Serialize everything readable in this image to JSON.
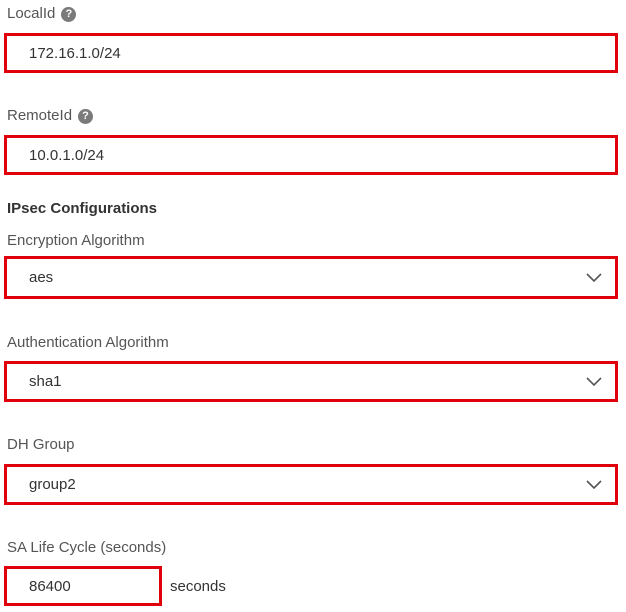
{
  "local_id": {
    "label": "LocalId",
    "help_icon": "question-circle-icon",
    "value": "172.16.1.0/24"
  },
  "remote_id": {
    "label": "RemoteId",
    "help_icon": "question-circle-icon",
    "value": "10.0.1.0/24"
  },
  "ipsec": {
    "section_title": "IPsec Configurations",
    "encryption": {
      "label": "Encryption Algorithm",
      "selected": "aes",
      "icon": "chevron-down-icon"
    },
    "authentication": {
      "label": "Authentication Algorithm",
      "selected": "sha1",
      "icon": "chevron-down-icon"
    },
    "dh_group": {
      "label": "DH Group",
      "selected": "group2",
      "icon": "chevron-down-icon"
    },
    "sa_life_cycle": {
      "label": "SA Life Cycle (seconds)",
      "value": "86400",
      "suffix": "seconds"
    }
  },
  "colors": {
    "highlight_border": "#e0000c",
    "label_text": "#555555",
    "value_text": "#333333",
    "help_icon_bg": "#7a7a7a"
  }
}
